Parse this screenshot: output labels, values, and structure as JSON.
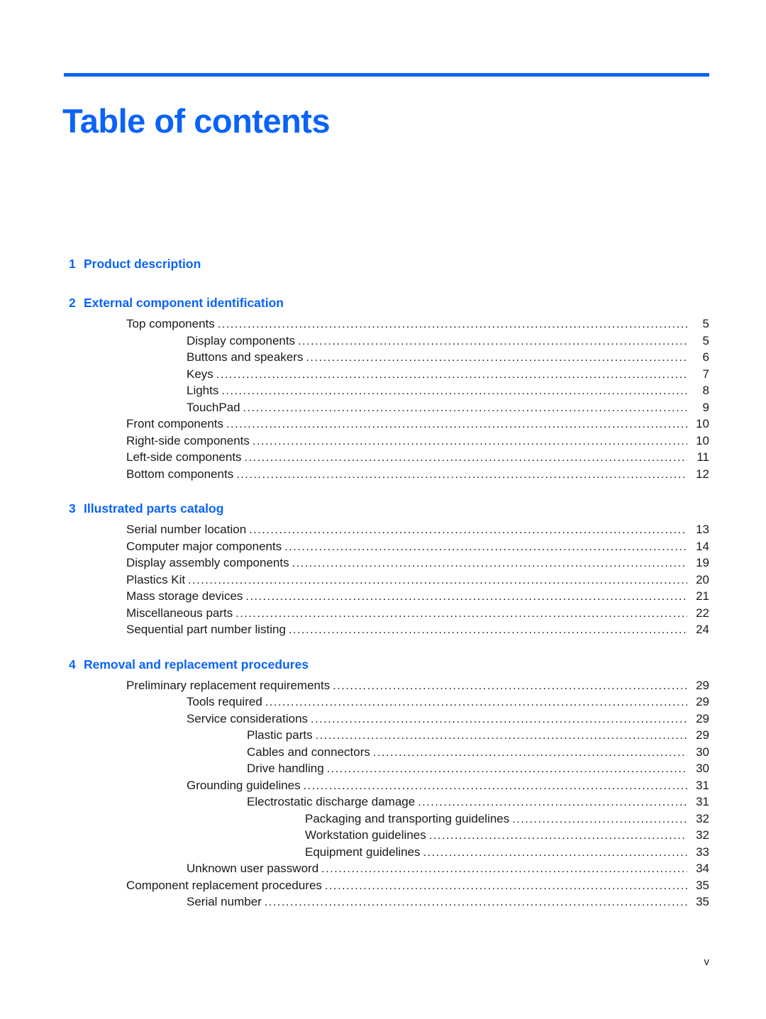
{
  "document": {
    "title": "Table of contents",
    "accent_color": "#0b63f6",
    "text_color": "#1a1a1a",
    "footer_folio": "v",
    "dot_leader": "..........................................................................................................................................................."
  },
  "toc": {
    "chapters": [
      {
        "number": "1",
        "title": "Product description",
        "entries": []
      },
      {
        "number": "2",
        "title": "External component identification",
        "entries": [
          {
            "label": "Top components",
            "page": "5",
            "level": 1
          },
          {
            "label": "Display components",
            "page": "5",
            "level": 2
          },
          {
            "label": "Buttons and speakers",
            "page": "6",
            "level": 2
          },
          {
            "label": "Keys",
            "page": "7",
            "level": 2
          },
          {
            "label": "Lights",
            "page": "8",
            "level": 2
          },
          {
            "label": "TouchPad",
            "page": "9",
            "level": 2
          },
          {
            "label": "Front components",
            "page": "10",
            "level": 1
          },
          {
            "label": "Right-side components",
            "page": "10",
            "level": 1
          },
          {
            "label": "Left-side components",
            "page": "11",
            "level": 1
          },
          {
            "label": "Bottom components",
            "page": "12",
            "level": 1
          }
        ]
      },
      {
        "number": "3",
        "title": "Illustrated parts catalog",
        "entries": [
          {
            "label": "Serial number location",
            "page": "13",
            "level": 1
          },
          {
            "label": "Computer major components",
            "page": "14",
            "level": 1
          },
          {
            "label": "Display assembly components",
            "page": "19",
            "level": 1
          },
          {
            "label": "Plastics Kit",
            "page": "20",
            "level": 1
          },
          {
            "label": "Mass storage devices",
            "page": "21",
            "level": 1
          },
          {
            "label": "Miscellaneous parts",
            "page": "22",
            "level": 1
          },
          {
            "label": "Sequential part number listing",
            "page": "24",
            "level": 1
          }
        ]
      },
      {
        "number": "4",
        "title": "Removal and replacement procedures",
        "entries": [
          {
            "label": "Preliminary replacement requirements",
            "page": "29",
            "level": 1
          },
          {
            "label": "Tools required",
            "page": "29",
            "level": 2
          },
          {
            "label": "Service considerations",
            "page": "29",
            "level": 2
          },
          {
            "label": "Plastic parts",
            "page": "29",
            "level": 3
          },
          {
            "label": "Cables and connectors",
            "page": "30",
            "level": 3
          },
          {
            "label": "Drive handling",
            "page": "30",
            "level": 3
          },
          {
            "label": "Grounding guidelines",
            "page": "31",
            "level": 2
          },
          {
            "label": "Electrostatic discharge damage",
            "page": "31",
            "level": 3
          },
          {
            "label": "Packaging and transporting guidelines",
            "page": "32",
            "level": 4
          },
          {
            "label": "Workstation guidelines",
            "page": "32",
            "level": 4
          },
          {
            "label": "Equipment guidelines",
            "page": "33",
            "level": 4
          },
          {
            "label": "Unknown user password",
            "page": "34",
            "level": 2
          },
          {
            "label": "Component replacement procedures",
            "page": "35",
            "level": 1
          },
          {
            "label": "Serial number",
            "page": "35",
            "level": 2
          }
        ]
      }
    ]
  }
}
